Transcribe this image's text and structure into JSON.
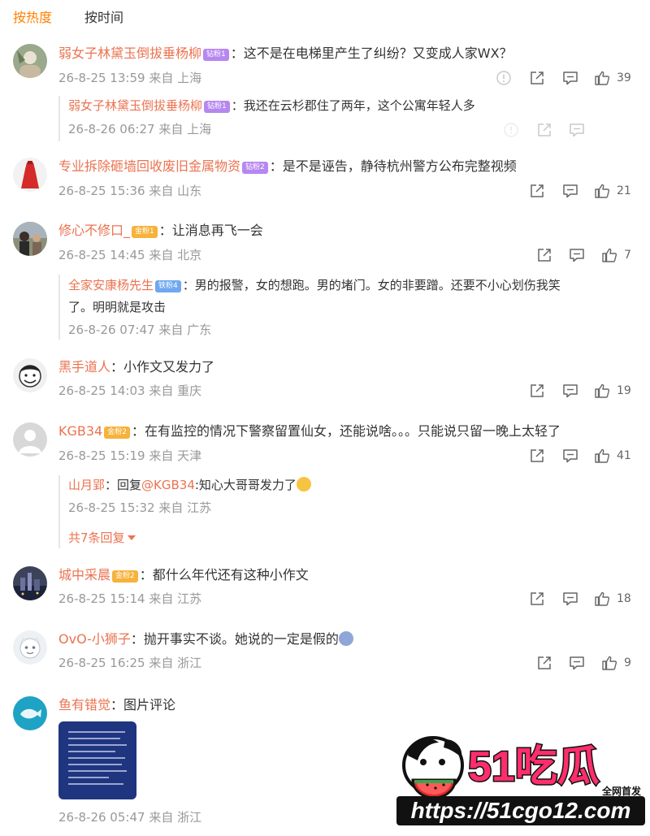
{
  "tabs": [
    "按热度",
    "按时间"
  ],
  "comments": [
    {
      "user": "弱女子林黛玉倒拔垂杨柳",
      "badge": "钻粉1",
      "text": "：这不是在电梯里产生了纠纷？又变成人家WX？",
      "time": "26-8-25 13:59",
      "from": "来自",
      "location": "上海",
      "likes": "39",
      "reply": {
        "user": "弱女子林黛玉倒拔垂杨柳",
        "badge": "钻粉1",
        "text": "：我还在云杉郡住了两年，这个公寓年轻人多",
        "time": "26-8-26 06:27",
        "location": "上海",
        "likes": ""
      }
    },
    {
      "user": "专业拆除砸墙回收废旧金属物资",
      "badge": "钻粉2",
      "text": "：是不是诬告，静待杭州警方公布完整视频",
      "time": "26-8-25 15:36",
      "from": "来自",
      "location": "山东",
      "likes": "21"
    },
    {
      "user": "修心不修口_",
      "badge": "金粉1",
      "text": "：让消息再飞一会",
      "time": "26-8-25 14:45",
      "from": "来自",
      "location": "北京",
      "likes": "7",
      "reply": {
        "user": "全家安康杨先生",
        "badge": "铁粉4",
        "text": "：男的报警，女的想跑。男的堵门。女的非要蹭。还要不小心划伤我笑",
        "text2": "了。明明就是攻击",
        "time": "26-8-26 07:47",
        "location": "广东"
      }
    },
    {
      "user": "黑手道人",
      "text": "：小作文又发力了",
      "time": "26-8-25 14:03",
      "from": "来自",
      "location": "重庆",
      "likes": "19"
    },
    {
      "user": "KGB34",
      "badge": "金粉2",
      "text": "：在有监控的情况下警察留置仙女，还能说啥。。。只能说只留一晚上太轻了",
      "time": "26-8-25 15:19",
      "from": "来自",
      "location": "天津",
      "likes": "41",
      "reply": {
        "user": "山月郢",
        "text": "：回复",
        "mention": "@KGB34",
        "text_after": ":知心大哥哥发力了",
        "time": "26-8-25 15:32",
        "location": "江苏",
        "more": "共7条回复"
      }
    },
    {
      "user": "城中采晨",
      "badge": "金粉2",
      "text": "：都什么年代还有这种小作文",
      "time": "26-8-25 15:14",
      "from": "来自",
      "location": "江苏",
      "likes": "18"
    },
    {
      "user": "OvO-小狮子",
      "text": "：抛开事实不谈。她说的一定是假的",
      "time": "26-8-25 16:25",
      "from": "来自",
      "location": "浙江",
      "likes": "9"
    },
    {
      "user": "鱼有错觉",
      "text": "：图片评论",
      "time": "26-8-26 05:47",
      "from": "来自",
      "location": "浙江"
    }
  ],
  "watermark": {
    "brand": "51吃瓜",
    "tag": "全网首发",
    "url": "https://51cgo12.com"
  },
  "colors": {
    "accent": "#ff8200",
    "username": "#eb7350",
    "meta": "#999999"
  }
}
